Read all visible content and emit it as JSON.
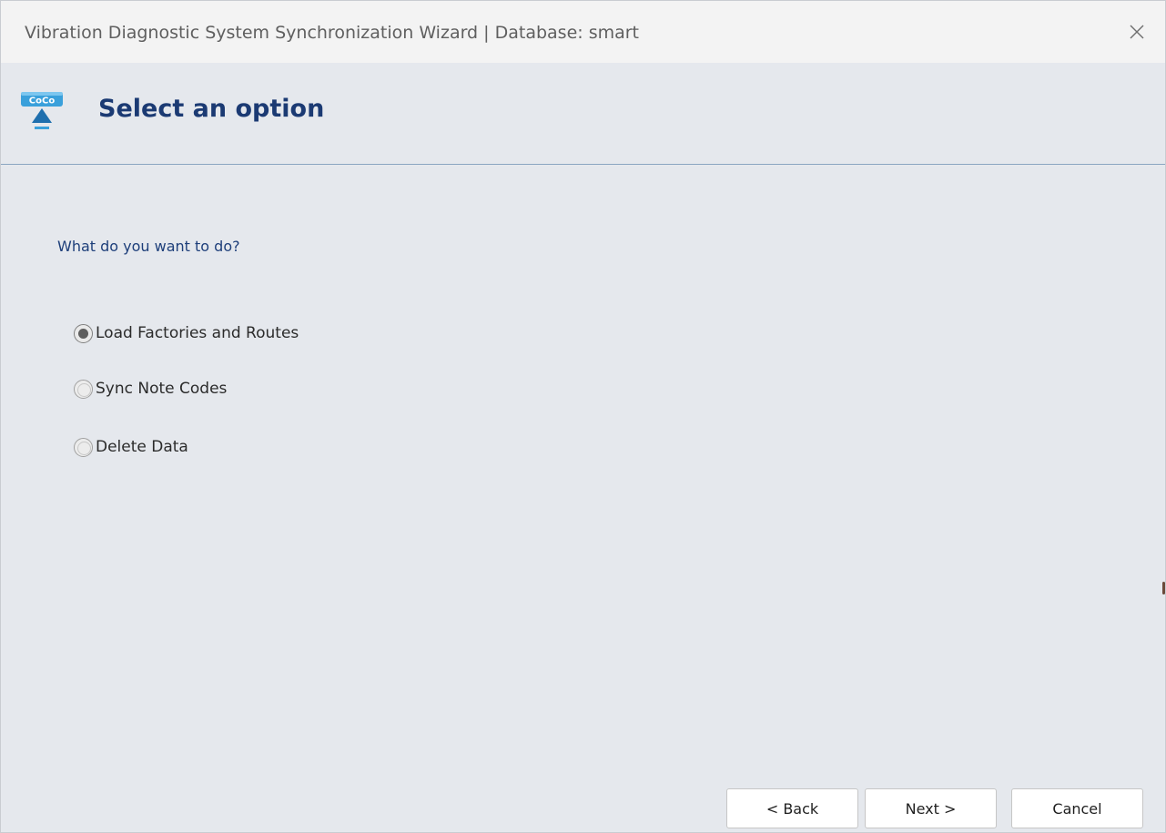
{
  "window": {
    "title": "Vibration Diagnostic System Synchronization Wizard | Database: smart"
  },
  "header": {
    "title": "Select an option",
    "logo_icon": "coco-sync-logo-icon",
    "logo_text": "CoCo"
  },
  "main": {
    "question": "What do you want to do?",
    "options": [
      {
        "label": "Load Factories and Routes",
        "selected": true
      },
      {
        "label": "Sync Note Codes",
        "selected": false
      },
      {
        "label": "Delete Data",
        "selected": false
      }
    ]
  },
  "footer": {
    "back_label": "< Back",
    "next_label": "Next >",
    "cancel_label": "Cancel"
  },
  "colors": {
    "header_title": "#1b3a73",
    "question_text": "#1e3f7a",
    "divider": "#8aa6c1",
    "background": "#e5e8ed"
  }
}
